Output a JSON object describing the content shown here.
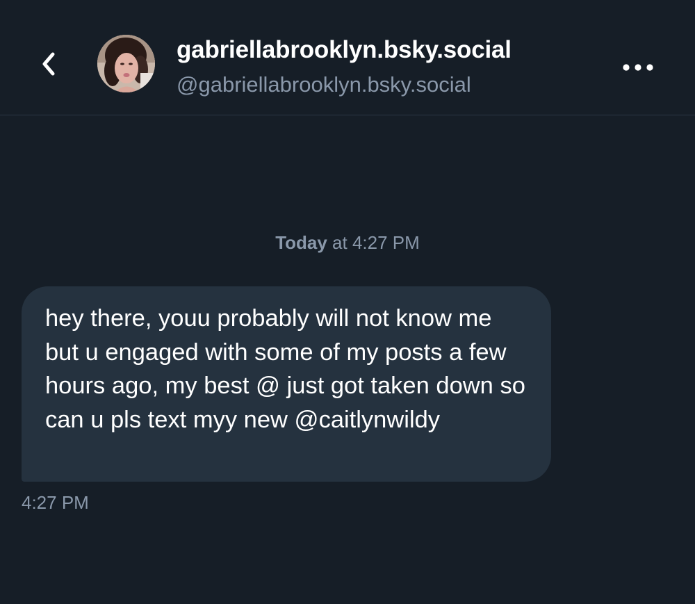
{
  "header": {
    "display_name": "gabriellabrooklyn.bsky.social",
    "handle": "@gabriellabrooklyn.bsky.social",
    "back_icon": "chevron-left-icon",
    "more_icon": "ellipsis-horizontal-icon",
    "avatar_alt": "profile photo"
  },
  "conversation": {
    "date_divider": {
      "day": "Today",
      "rest": " at 4:27 PM"
    },
    "messages": [
      {
        "text": "hey there, youu probably will not know me but u engaged with some of my posts a few hours ago, my best @ just got taken down so can u pls text myy new @caitlynwildy",
        "time": "4:27 PM"
      }
    ]
  },
  "colors": {
    "background": "#161e27",
    "bubble": "#25323f",
    "muted_text": "#8a98aa",
    "text": "#ffffff"
  }
}
